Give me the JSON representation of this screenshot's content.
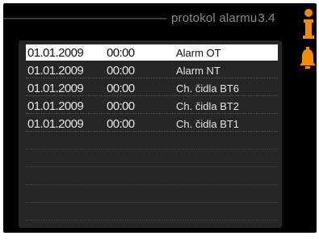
{
  "header": {
    "title": "protokol alarmu",
    "menu_number": "3.4"
  },
  "icons": {
    "info": "info-icon",
    "alarm": "bell-icon",
    "accent_color": "#f28c00"
  },
  "alarm_log": {
    "rows": [
      {
        "date": "01.01.2009",
        "time": "00:00",
        "text": "Alarm OT",
        "selected": true
      },
      {
        "date": "01.01.2009",
        "time": "00:00",
        "text": "Alarm NT",
        "selected": false
      },
      {
        "date": "01.01.2009",
        "time": "00:00",
        "text": "Ch. čidla BT6",
        "selected": false
      },
      {
        "date": "01.01.2009",
        "time": "00:00",
        "text": "Ch. čidla BT2",
        "selected": false
      },
      {
        "date": "01.01.2009",
        "time": "00:00",
        "text": "Ch. čidla BT1",
        "selected": false
      }
    ]
  }
}
